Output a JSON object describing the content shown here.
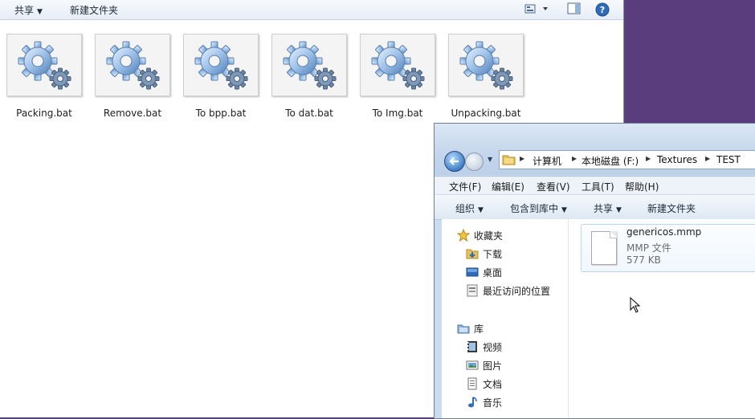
{
  "background_window": {
    "toolbar": {
      "share_label": "共享",
      "new_folder_label": "新建文件夹"
    },
    "files": [
      {
        "name": "Packing.bat",
        "icon": "gear-batch-icon"
      },
      {
        "name": "Remove.bat",
        "icon": "gear-batch-icon"
      },
      {
        "name": "To bpp.bat",
        "icon": "gear-batch-icon"
      },
      {
        "name": "To dat.bat",
        "icon": "gear-batch-icon"
      },
      {
        "name": "To Img.bat",
        "icon": "gear-batch-icon"
      },
      {
        "name": "Unpacking.bat",
        "icon": "gear-batch-icon"
      }
    ]
  },
  "foreground_window": {
    "breadcrumb": [
      "计算机",
      "本地磁盘 (F:)",
      "Textures",
      "TEST"
    ],
    "menu": [
      "文件(F)",
      "编辑(E)",
      "查看(V)",
      "工具(T)",
      "帮助(H)"
    ],
    "commands": [
      "组织",
      "包含到库中",
      "共享",
      "新建文件夹"
    ],
    "favorites": {
      "header": "收藏夹",
      "items": [
        {
          "label": "下载",
          "icon": "downloads-folder-icon"
        },
        {
          "label": "桌面",
          "icon": "desktop-icon"
        },
        {
          "label": "最近访问的位置",
          "icon": "recent-places-icon"
        }
      ]
    },
    "libraries": {
      "header": "库",
      "items": [
        {
          "label": "视频",
          "icon": "video-icon"
        },
        {
          "label": "图片",
          "icon": "pictures-icon"
        },
        {
          "label": "文档",
          "icon": "documents-icon"
        },
        {
          "label": "音乐",
          "icon": "music-icon"
        }
      ]
    },
    "file": {
      "name": "genericos.mmp",
      "type": "MMP 文件",
      "size": "577 KB"
    }
  },
  "colors": {
    "desktop": "#5a3d7c",
    "accent": "#3f7fc8",
    "selection_border": "#b8d6f5"
  }
}
